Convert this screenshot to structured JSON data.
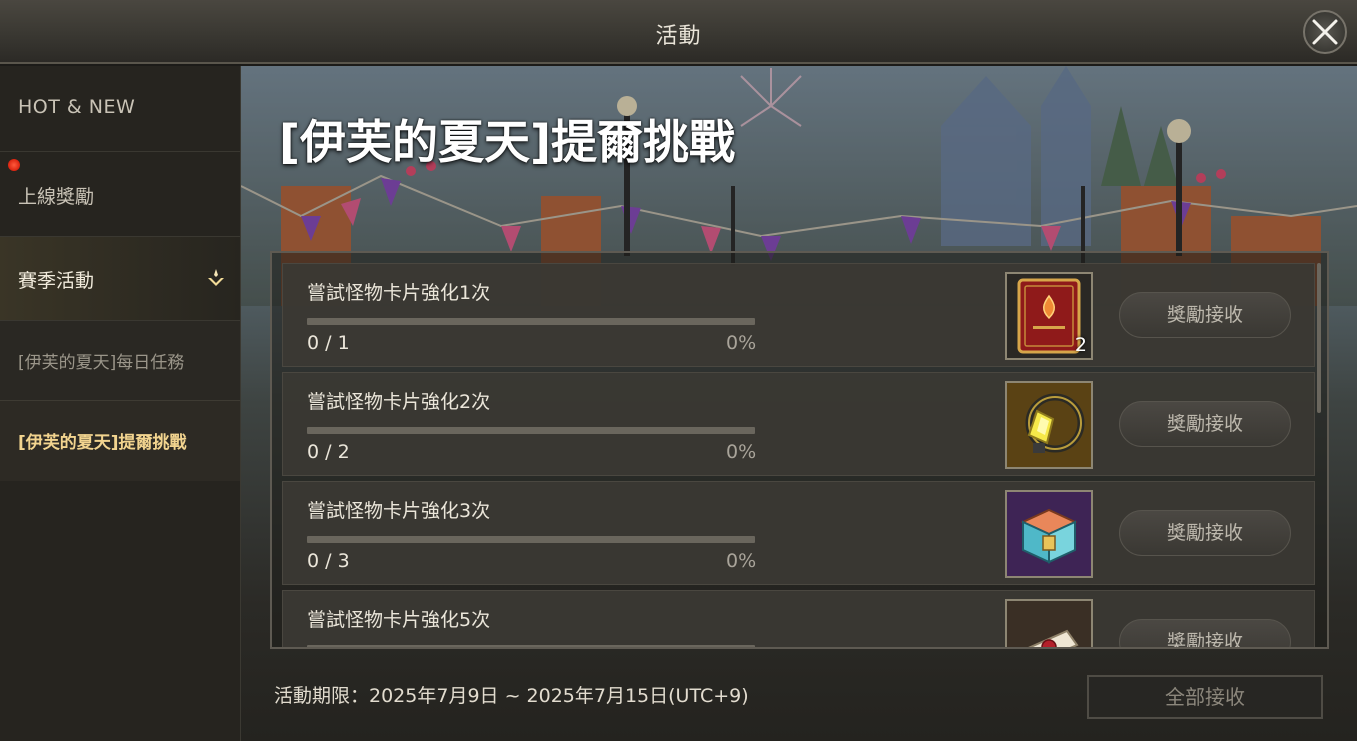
{
  "window": {
    "title": "活動"
  },
  "sidebar": {
    "items": [
      {
        "label": "HOT & NEW"
      },
      {
        "label": "上線獎勵",
        "has_notification": true
      },
      {
        "label": "賽季活動",
        "expanded": true
      }
    ],
    "sub_items": [
      {
        "label": "[伊芙的夏天]每日任務"
      },
      {
        "label": "[伊芙的夏天]提爾挑戰",
        "selected": true
      }
    ]
  },
  "main": {
    "event_title": "[伊芙的夏天]提爾挑戰",
    "tasks": [
      {
        "name": "嘗試怪物卡片強化1次",
        "count": "0 / 1",
        "percent": "0%",
        "progress": 0,
        "reward_icon": "red-card-book-icon",
        "reward_qty": "2",
        "button": "獎勵接收"
      },
      {
        "name": "嘗試怪物卡片強化2次",
        "count": "0 / 2",
        "percent": "0%",
        "progress": 0,
        "reward_icon": "yellow-lantern-icon",
        "reward_qty": "",
        "button": "獎勵接收"
      },
      {
        "name": "嘗試怪物卡片強化3次",
        "count": "0 / 3",
        "percent": "0%",
        "progress": 0,
        "reward_icon": "treasure-chest-icon",
        "reward_qty": "",
        "button": "獎勵接收"
      },
      {
        "name": "嘗試怪物卡片強化5次",
        "count": "",
        "percent": "",
        "progress": 0,
        "reward_icon": "scroll-icon",
        "reward_qty": "",
        "button": "獎勵接收"
      }
    ],
    "period": "活動期限：2025年7月9日 ~ 2025年7月15日(UTC+9)",
    "claim_all": "全部接收"
  },
  "colors": {
    "accent": "#f2d48f",
    "notification": "#e0301a"
  }
}
